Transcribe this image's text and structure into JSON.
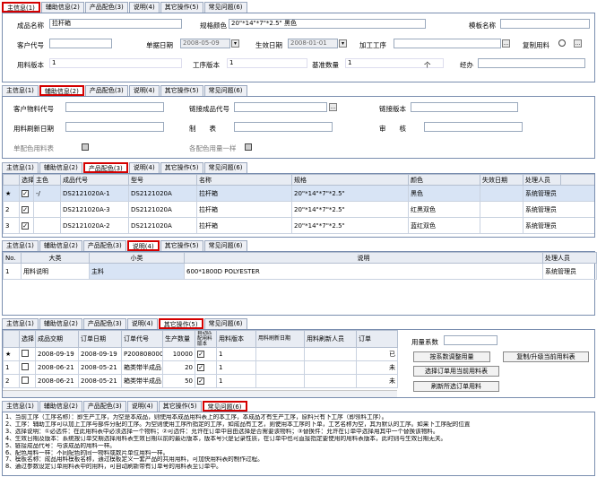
{
  "tabs": {
    "main": "主信息(1)",
    "aux": "辅助信息(2)",
    "cfg": "产品配色(3)",
    "desc": "说明(4)",
    "other": "其它操作(5)",
    "faq": "常见问题(6)"
  },
  "p1": {
    "l_name": "成品名称",
    "name": "拉杆箱",
    "l_spec": "规格颜色",
    "spec": "20\"*14\"*7\"*2.5\"  黑色",
    "l_model": "模板名称",
    "l_cust": "客户代号",
    "l_date": "单据日期",
    "date": "2008-05-09",
    "l_eff": "生效日期",
    "eff": "2008-01-01",
    "l_proc": "加工工序",
    "l_copy": "复制用料",
    "l_mat_ver": "用料版本",
    "mat_ver": "1",
    "l_proc_ver": "工序版本",
    "proc_ver": "1",
    "l_base": "基准数量",
    "base": "1",
    "base_unit": "个",
    "l_by": "经办"
  },
  "p2": {
    "l_cust_code": "客户物料代号",
    "l_link_code": "链接成品代号",
    "l_link_ver": "链接版本",
    "l_refresh": "用料刷新日期",
    "l_make": "制　　表",
    "l_audit": "审　　核",
    "l_single": "单配色用料表",
    "l_same": "各配色用量一样"
  },
  "p3": {
    "headers": [
      "选择",
      "主色",
      "成品代号",
      "型号",
      "名称",
      "规格",
      "颜色",
      "失效日期",
      "处理人员"
    ],
    "rows": [
      {
        "mark": "★",
        "main": "-/",
        "code": "DS2121020A-1",
        "model": "DS2121020A",
        "name": "拉杆箱",
        "spec": "20\"*14\"*7\"*2.5\"",
        "color": "黑色",
        "exp": "",
        "user": "系统管理员"
      },
      {
        "mark": "2",
        "main": "",
        "code": "DS2121020A-3",
        "model": "DS2121020A",
        "name": "拉杆箱",
        "spec": "20\"*14\"*7\"*2.5\"",
        "color": "红黑双色",
        "exp": "",
        "user": "系统管理员"
      },
      {
        "mark": "3",
        "main": "",
        "code": "DS2121020A-2",
        "model": "DS2121020A",
        "name": "拉杆箱",
        "spec": "20\"*14\"*7\"*2.5\"",
        "color": "蓝红双色",
        "exp": "",
        "user": "系统管理员"
      }
    ]
  },
  "p4": {
    "headers": [
      "No.",
      "大类",
      "小类",
      "说明",
      "处理人员"
    ],
    "row": {
      "no": "1",
      "big": "用料说明",
      "small": "主料",
      "desc": "600*1800D POLYESTER",
      "user": "系统管理员"
    }
  },
  "p5": {
    "headers": [
      "选择",
      "成品交期",
      "订单日期",
      "订单代号",
      "生产数量",
      "自动匹配用料版本",
      "用料版本",
      "用料刷新日期",
      "用料刷新人员",
      "订单"
    ],
    "rows": [
      {
        "mark": "★",
        "due": "2008-09-19",
        "odate": "2008-09-19",
        "ocode": "P2008080002",
        "qty": "10000",
        "ver": "1",
        "tail": "已"
      },
      {
        "mark": "1",
        "due": "2008-06-21",
        "odate": "2008-05-21",
        "ocode": "箱类带半成品",
        "qty": "20",
        "ver": "1",
        "tail": "未"
      },
      {
        "mark": "2",
        "due": "2008-06-21",
        "odate": "2008-05-21",
        "ocode": "箱类带半成品",
        "qty": "50",
        "ver": "1",
        "tail": "未"
      }
    ],
    "qty_label": "用量系数",
    "btn_adjust": "按系数调整用量",
    "btn_copy": "复制/升级当前用料表",
    "btn_select": "选择订单用当前用料表",
    "btn_refresh": "刷新所选订单用料"
  },
  "p6": {
    "lines": [
      "1、当前工序（工序名称）：即生产工序，为空是本成品，则使用本成品用料表上的本工序，本成品才有生产工序，原料只有下工序（即领料工序）。",
      "2、工序：辅助工序可以加上工序与部件分配的工序。为空则使用工序所指定的工序，如成品有工艺，则使用本工序的下单，工艺名称为空，其为默认的工序。如果下工序配的位置",
      "3、选择说明：①必选件：在此用料表中必须选择一个物料；②可选件：允许在订单中自由选择是否需要该物料；③替换件：允许在订单中选择用其中一个替换该物料。",
      "4、生效日期及版本：系统按订单交期选择用料表生效日期以前的最近版本，版本号只是记录性质，在订单中也可直接指定要使用的用料表版本，此时则与生效日期无关。",
      "5、链接成品代号：与该成品的用料一样。",
      "6、配色用料一样：不同配色的同一物料或数片单位用料一样。",
      "7、模板名称：成品用料模板名称，通过模板定义一套产品的共用用料，可加快用料表的制作过程。",
      "8、通过参数设定订单用料表中的用料，可自动刷新带有订单号的用料表至订单中。"
    ]
  }
}
